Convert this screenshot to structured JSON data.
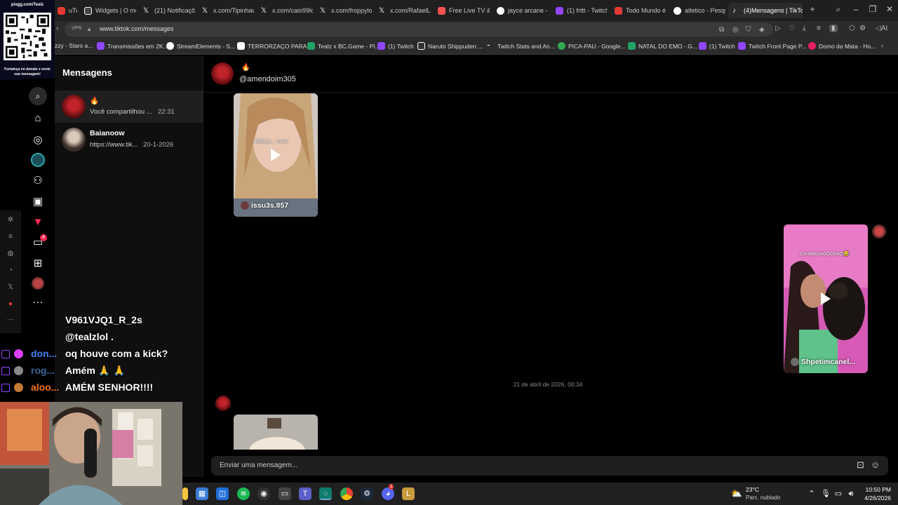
{
  "browser": {
    "tabs": [
      {
        "label": "uTube",
        "color": "#e53935"
      },
      {
        "label": "Widgets | O me",
        "color": "#ffffff"
      },
      {
        "label": "(21) Notificaçõ",
        "color": "#ffffff"
      },
      {
        "label": "x.com/Tipinhaw",
        "color": "#ffffff"
      },
      {
        "label": "x.com/caio99lo",
        "color": "#ffffff"
      },
      {
        "label": "x.com/froppylol",
        "color": "#ffffff"
      },
      {
        "label": "x.com/RafaelLu",
        "color": "#ffffff"
      },
      {
        "label": "Free Live TV &",
        "color": "#ff5252"
      },
      {
        "label": "jayce arcane - P",
        "color": "#4285f4"
      },
      {
        "label": "(1) frttt - Twitch",
        "color": "#9146ff"
      },
      {
        "label": "Todo Mundo é",
        "color": "#e53935"
      },
      {
        "label": "atletico - Pesqu",
        "color": "#4285f4"
      },
      {
        "label": "(4)Mensagens | TikTok",
        "color": "#ffffff"
      }
    ],
    "new_tab": "+",
    "url": "www.tiktok.com/messages",
    "vpn": "VPN",
    "ai_label": "AI",
    "bookmarks": [
      {
        "label": "zzy - Stars a...",
        "color": "#888888"
      },
      {
        "label": "Transmissões em 2K...",
        "color": "#9146ff"
      },
      {
        "label": "StreamElements - S...",
        "color": "#ffffff"
      },
      {
        "label": "TERRORZAÇO PARA...",
        "color": "#ffffff"
      },
      {
        "label": "Tealz x BC.Game - Pl...",
        "color": "#21a366"
      },
      {
        "label": "(1) Twitch",
        "color": "#9146ff"
      },
      {
        "label": "Naruto Shippuden:...",
        "color": "#ffffff"
      },
      {
        "label": "Twitch Stats and An...",
        "color": "#ffffff"
      },
      {
        "label": "PICA-PAU - Google...",
        "color": "#34a853"
      },
      {
        "label": "NATAL DO EMO - G...",
        "color": "#21a366"
      },
      {
        "label": "(1) Twitch",
        "color": "#9146ff"
      },
      {
        "label": "Twitch Front Page P...",
        "color": "#9146ff"
      },
      {
        "label": "Domo da Mata - Ho...",
        "color": "#e91e63"
      }
    ]
  },
  "overlay": {
    "qr_title": "pixgg.com/Tealz",
    "qr_caption": "Fortaleça no donate e envie sua mensagem!"
  },
  "messages_panel": {
    "title": "Mensagens",
    "notification_count": "4",
    "conversations": [
      {
        "name": "🔥",
        "preview": "Você compartilhou ...",
        "time": "22:31",
        "selected": true
      },
      {
        "name": "Baianoow",
        "preview": "https://www.tik...",
        "time": "20-1-2026",
        "selected": false
      }
    ]
  },
  "chat": {
    "lines": [
      {
        "user": "",
        "text": "V961VJQ1_R_2s"
      },
      {
        "user": "",
        "text": "@tealzlol ."
      },
      {
        "user": "don...",
        "user_color": "#3b82f6",
        "text": "oq houve com a kick?"
      },
      {
        "user": "",
        "text": "Amém 🙏 🙏"
      },
      {
        "user": "aloo...",
        "user_color": "#f97316",
        "text": "AMÉM SENHOR!!!!"
      }
    ],
    "second_user": "rog...",
    "second_user_color": "#60a5fa"
  },
  "conversation": {
    "flame": "🔥",
    "username": "@amendoim305",
    "cards": [
      {
        "user": "issu3s.857",
        "caption": "AltoLe...   core"
      },
      {
        "user": "Shpetimcanel...",
        "caption": "CaneloooooOOooO😂"
      }
    ],
    "date_separator": "21 de abril de 2026, 00:34",
    "input_placeholder": "Enviar uma mensagem..."
  },
  "taskbar": {
    "temperature": "23°C",
    "weather": "Parc. nublado",
    "time": "10:50 PM",
    "date": "4/26/2026",
    "badge": "1"
  }
}
